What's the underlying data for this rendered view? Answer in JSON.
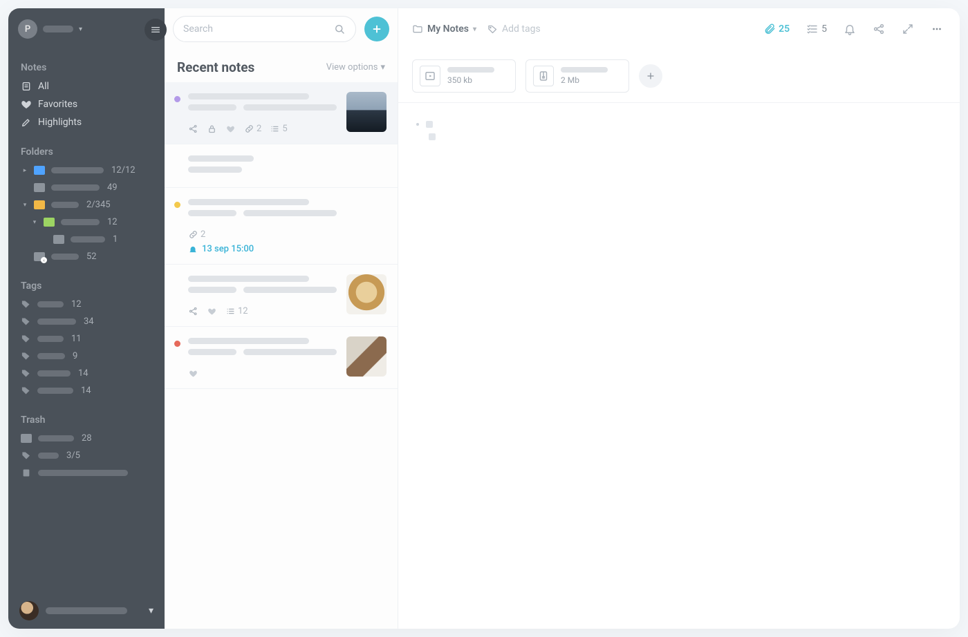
{
  "sidebar": {
    "avatar_letter": "P",
    "sections": {
      "notes": {
        "heading": "Notes",
        "items": [
          {
            "icon": "note-icon",
            "label": "All"
          },
          {
            "icon": "heart-icon",
            "label": "Favorites"
          },
          {
            "icon": "highlighter-icon",
            "label": "Highlights"
          }
        ]
      },
      "folders": {
        "heading": "Folders",
        "tree": [
          {
            "arrow": "right",
            "color": "#4fa3ff",
            "count": "12/12",
            "indent": 1,
            "skel": 76
          },
          {
            "arrow": "",
            "color": "#8d949c",
            "count": "49",
            "indent": 1,
            "skel": 70
          },
          {
            "arrow": "down",
            "color": "#f2b846",
            "count": "2/345",
            "indent": 1,
            "skel": 40
          },
          {
            "arrow": "down",
            "color": "#9cd463",
            "count": "12",
            "indent": 2,
            "skel": 56
          },
          {
            "arrow": "",
            "color": "#8d949c",
            "count": "1",
            "indent": 3,
            "skel": 50
          },
          {
            "arrow": "",
            "color": "#8d949c",
            "count": "52",
            "indent": 1,
            "skel": 40,
            "shared": true
          }
        ]
      },
      "tags": {
        "heading": "Tags",
        "items": [
          {
            "count": "12",
            "skel": 38
          },
          {
            "count": "34",
            "skel": 56
          },
          {
            "count": "11",
            "skel": 38
          },
          {
            "count": "9",
            "skel": 40
          },
          {
            "count": "14",
            "skel": 48
          },
          {
            "count": "14",
            "skel": 52
          }
        ]
      },
      "trash": {
        "heading": "Trash",
        "items": [
          {
            "icon": "folder-icon",
            "count": "28",
            "skel": 52
          },
          {
            "icon": "tag-icon",
            "count": "3/5",
            "skel": 30
          },
          {
            "icon": "note-icon",
            "count": "",
            "skel": 130
          }
        ]
      }
    }
  },
  "listpane": {
    "search_placeholder": "Search",
    "heading": "Recent notes",
    "view_options_label": "View options",
    "notes": [
      {
        "selected": true,
        "dot": "#b39ae8",
        "thumb": "ocean",
        "meta": {
          "share": true,
          "lock": true,
          "heart": true,
          "link_count": "2",
          "list_count": "5"
        }
      },
      {
        "selected": false,
        "dot": null,
        "thumb": null,
        "title_only": true,
        "meta": {}
      },
      {
        "selected": false,
        "dot": "#f3c94c",
        "thumb": null,
        "meta": {
          "link_count": "2"
        },
        "reminder": "13 sep 15:00"
      },
      {
        "selected": false,
        "dot": null,
        "thumb": "dog",
        "meta": {
          "share": true,
          "heart": true,
          "list_count": "12"
        }
      },
      {
        "selected": false,
        "dot": "#e66a5b",
        "thumb": "coffee",
        "meta": {
          "heart": true
        }
      }
    ]
  },
  "editor": {
    "breadcrumb": "My Notes",
    "add_tags_placeholder": "Add tags",
    "toolbar": {
      "attach_count": "25",
      "task_count": "5"
    },
    "attachments": [
      {
        "icon": "video-file-icon",
        "size": "350 kb"
      },
      {
        "icon": "archive-file-icon",
        "size": "2 Mb"
      }
    ]
  }
}
